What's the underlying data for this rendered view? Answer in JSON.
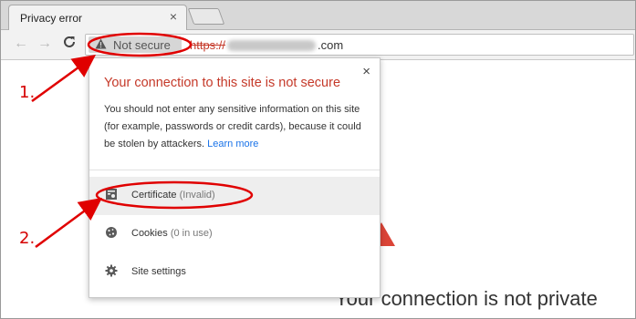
{
  "tab": {
    "title": "Privacy error",
    "close": "×"
  },
  "toolbar": {
    "back_glyph": "←",
    "forward_glyph": "→",
    "reload_glyph": "C",
    "security_icon": "warning-triangle-icon",
    "security_label": "Not secure",
    "url_scheme": "https://",
    "url_tld": ".com"
  },
  "page": {
    "heading": "Your connection is not private",
    "accent": "#db4437"
  },
  "popup": {
    "close": "×",
    "title": "Your connection to this site is not secure",
    "body": "You should not enter any sensitive information on this site (for example, passwords or credit cards), because it could be stolen by attackers. ",
    "link": "Learn more",
    "rows": [
      {
        "icon": "certificate-icon",
        "label": "Certificate",
        "sub": "(Invalid)"
      },
      {
        "icon": "cookie-icon",
        "label": "Cookies",
        "sub": "(0 in use)"
      },
      {
        "icon": "gear-icon",
        "label": "Site settings",
        "sub": ""
      }
    ]
  },
  "annotations": {
    "step1": "1.",
    "step2": "2.",
    "color": "#d50000"
  }
}
